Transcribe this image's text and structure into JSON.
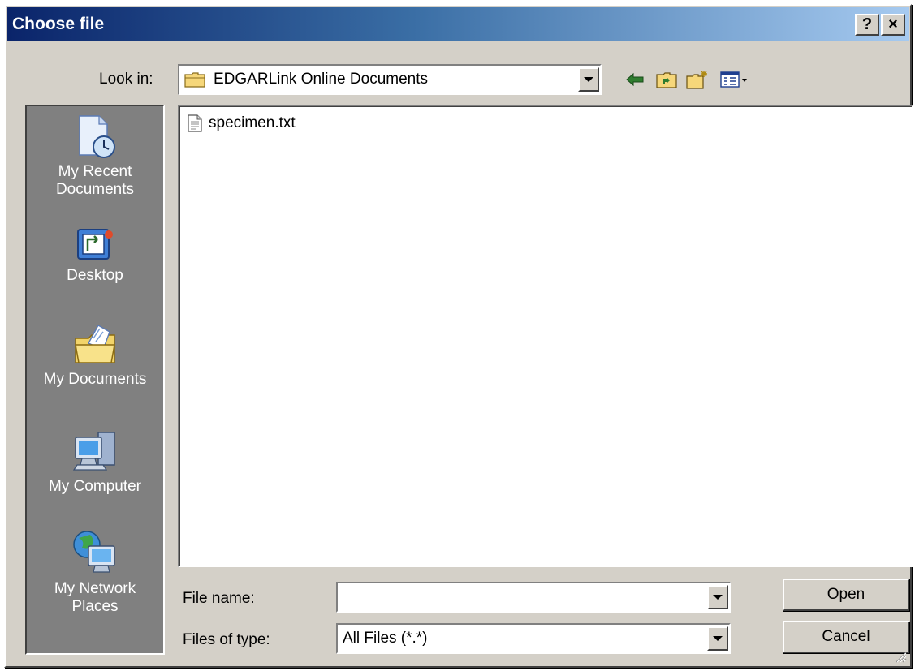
{
  "window": {
    "title": "Choose file",
    "help_button": "?",
    "close_button": "×"
  },
  "look_in": {
    "label": "Look in:",
    "value": "EDGARLink Online Documents"
  },
  "toolbar": {
    "icons": [
      "back-arrow-icon",
      "up-one-level-icon",
      "create-new-folder-icon",
      "view-menu-icon"
    ]
  },
  "places_bar": {
    "items": [
      {
        "label_line1": "My Recent",
        "label_line2": "Documents",
        "icon": "recent-documents-icon"
      },
      {
        "label_line1": "Desktop",
        "label_line2": "",
        "icon": "desktop-icon"
      },
      {
        "label_line1": "My Documents",
        "label_line2": "",
        "icon": "my-documents-icon"
      },
      {
        "label_line1": "My Computer",
        "label_line2": "",
        "icon": "my-computer-icon"
      },
      {
        "label_line1": "My Network",
        "label_line2": "Places",
        "icon": "network-places-icon"
      }
    ]
  },
  "file_list": {
    "items": [
      {
        "name": "specimen.txt",
        "icon": "text-file-icon"
      }
    ]
  },
  "file_name": {
    "label": "File name:",
    "value": ""
  },
  "file_type": {
    "label": "Files of type:",
    "value": "All Files (*.*)"
  },
  "buttons": {
    "open": "Open",
    "cancel": "Cancel"
  },
  "colors": {
    "dialog_bg": "#d4d0c8",
    "title_gradient_start": "#0a246a",
    "title_gradient_end": "#a6caf0",
    "places_bg": "#808080"
  }
}
